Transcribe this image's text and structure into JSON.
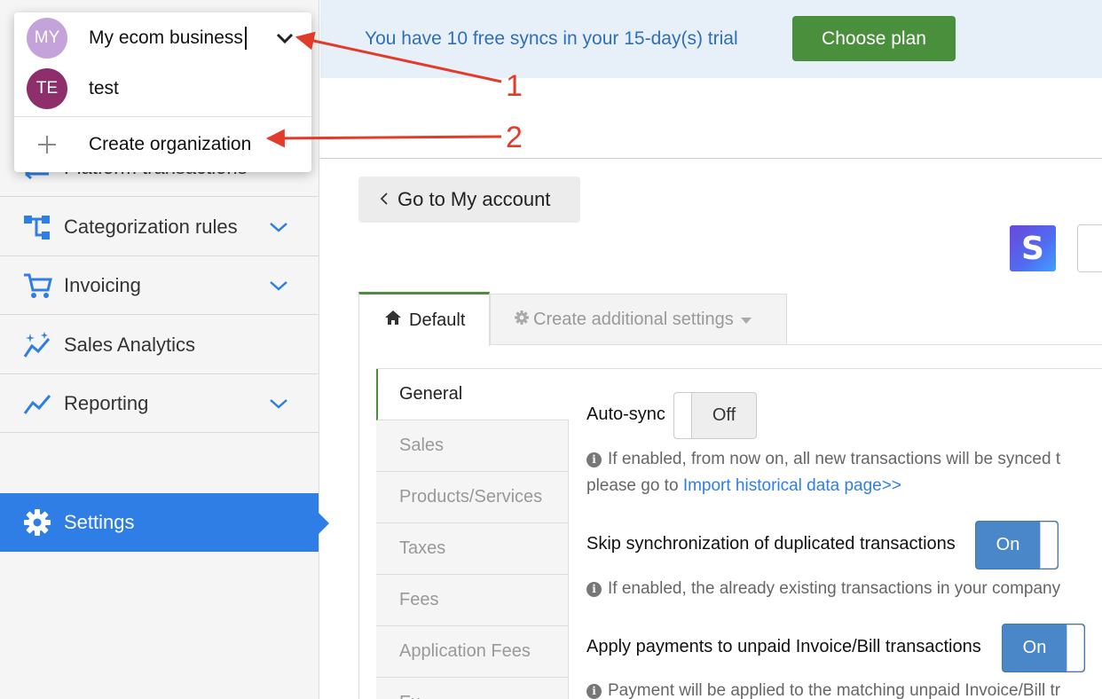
{
  "org_dropdown": {
    "orgs": [
      {
        "initials": "MY",
        "name": "My ecom business",
        "avatar_color": "#c3a3d9"
      },
      {
        "initials": "TE",
        "name": "test",
        "avatar_color": "#8e2f6b"
      }
    ],
    "create_label": "Create organization"
  },
  "sidebar": {
    "items": [
      {
        "label": "Platform transactions",
        "icon": "transactions-icon"
      },
      {
        "label": "Categorization rules",
        "icon": "rules-icon"
      },
      {
        "label": "Invoicing",
        "icon": "cart-icon"
      },
      {
        "label": "Sales Analytics",
        "icon": "analytics-icon"
      },
      {
        "label": "Reporting",
        "icon": "trend-icon"
      },
      {
        "label": "Settings",
        "icon": "gear-icon"
      }
    ],
    "active": "Settings",
    "accent_color": "#2f7ee6"
  },
  "banner": {
    "text": "You have 10 free syncs in your 15-day(s) trial",
    "button_label": "Choose plan",
    "button_color": "#4a8f3c"
  },
  "back_button_label": "Go to My account",
  "integration_logo": "S",
  "tabs": {
    "default_label": "Default",
    "additional_label": "Create additional settings"
  },
  "subnav": {
    "items": [
      "General",
      "Sales",
      "Products/Services",
      "Taxes",
      "Fees",
      "Application Fees",
      "Ex"
    ],
    "active": "General"
  },
  "settings": {
    "auto_sync": {
      "label": "Auto-sync",
      "state": "Off",
      "help_line1": "If enabled, from now on, all new transactions will be synced t",
      "help_line2_prefix": "please go to ",
      "help_link": "Import historical data page>>"
    },
    "skip_duplicates": {
      "label": "Skip synchronization of duplicated transactions",
      "state": "On",
      "help": "If enabled, the already existing transactions in your company"
    },
    "apply_payments": {
      "label": "Apply payments to unpaid Invoice/Bill transactions",
      "state": "On",
      "help": "Payment will be applied to the matching unpaid Invoice/Bill tr"
    }
  },
  "annotations": {
    "marker_1": "1",
    "marker_2": "2",
    "color": "#e23b2a"
  }
}
